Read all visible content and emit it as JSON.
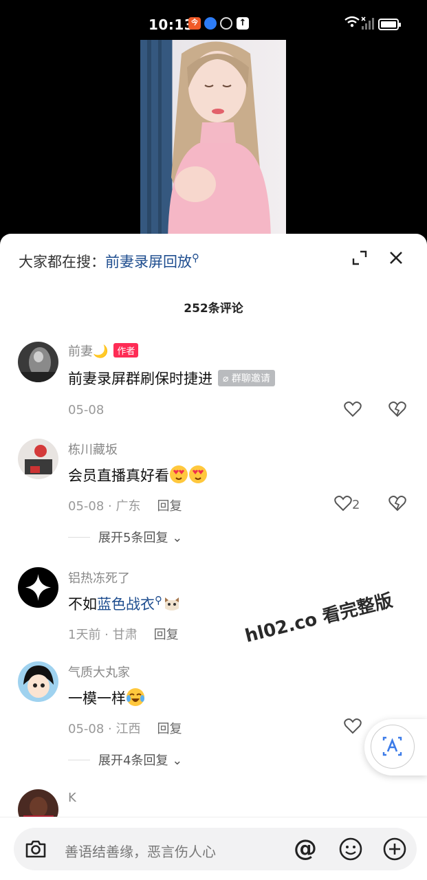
{
  "status_bar": {
    "time": "10:13",
    "app_badge": "今"
  },
  "search": {
    "prefix": "大家都在搜：",
    "query": "前妻录屏回放"
  },
  "comment_count": "252条评论",
  "comments": [
    {
      "user": "前妻🌙",
      "badge": "作者",
      "text": "前妻录屏群刷保时捷进",
      "tag": "群聊邀请",
      "date": "05-08"
    },
    {
      "user": "栋川藏坂",
      "text": "会员直播真好看",
      "meta": "05-08 · 广东",
      "reply": "回复",
      "likes": "2",
      "expand": "展开5条回复"
    },
    {
      "user": "铝热冻死了",
      "text_before": "不如",
      "link_text": "蓝色战衣",
      "meta": "1天前 · 甘肃",
      "reply": "回复"
    },
    {
      "user": "气质大丸家",
      "text": "一模一样",
      "meta": "05-08 · 江西",
      "reply": "回复",
      "expand": "展开4条回复"
    },
    {
      "user": "K"
    }
  ],
  "watermark": "hl02.co 看完整版",
  "input": {
    "placeholder": "善语结善缘，恶言伤人心",
    "at_symbol": "@"
  },
  "icons": [
    "camera-icon",
    "emoji-icon",
    "plus-icon",
    "heart-icon",
    "dislike-icon",
    "expand-icon",
    "close-icon",
    "translate-icon"
  ],
  "colors": {
    "link": "#1e4d8f",
    "author_badge": "#fe2c55",
    "tag": "#b9bbbe"
  }
}
